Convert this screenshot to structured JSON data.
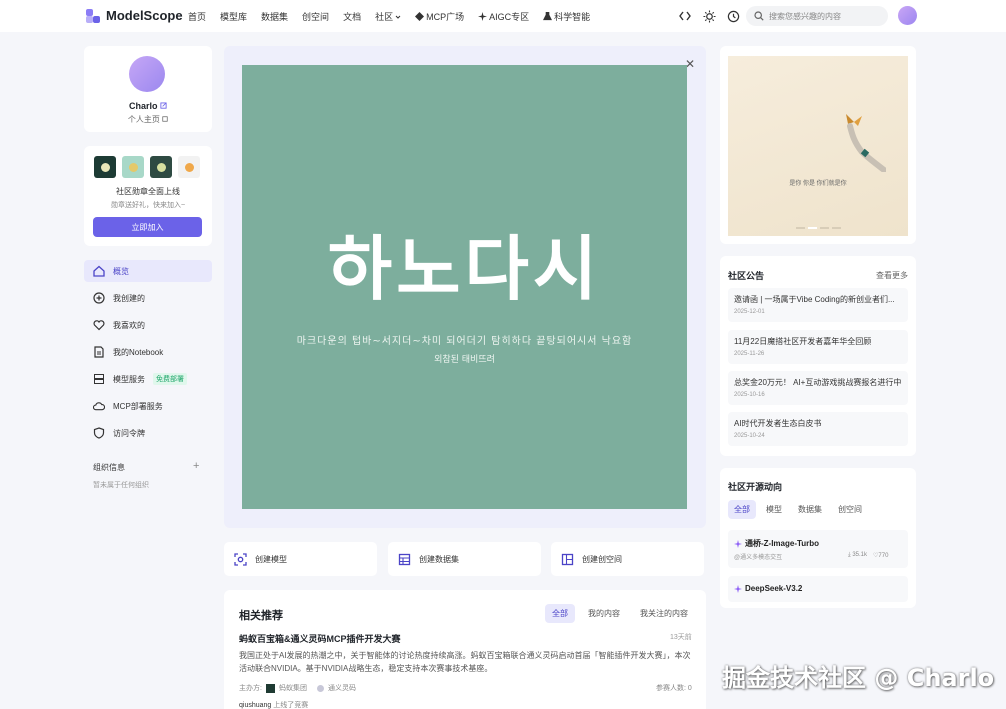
{
  "app": {
    "name": "ModelScope"
  },
  "nav": {
    "items": [
      "首页",
      "模型库",
      "数据集",
      "创空间",
      "文档",
      "社区",
      "MCP广场",
      "AIGC专区",
      "科学智能"
    ]
  },
  "search": {
    "placeholder": "搜索您感兴趣的内容"
  },
  "profile": {
    "name": "Charlo",
    "subtitle": "个人主页"
  },
  "badges": {
    "title": "社区勋章全面上线",
    "subtitle": "勋章送好礼，快来加入~",
    "join_label": "立即加入",
    "colors": [
      "#1d3b34",
      "#a8d8c8",
      "#2e4a42",
      "#f2f2f2"
    ]
  },
  "menu": {
    "items": [
      {
        "label": "概览",
        "icon": "home-icon"
      },
      {
        "label": "我创建的",
        "icon": "plus-circle-icon"
      },
      {
        "label": "我喜欢的",
        "icon": "heart-icon"
      },
      {
        "label": "我的Notebook",
        "icon": "notebook-icon"
      },
      {
        "label": "模型服务",
        "icon": "server-icon",
        "tag": "免费部署"
      },
      {
        "label": "MCP部署服务",
        "icon": "cloud-icon"
      },
      {
        "label": "访问令牌",
        "icon": "shield-icon"
      }
    ]
  },
  "org": {
    "title": "组织信息",
    "empty": "暂未属于任何组织"
  },
  "poster": {
    "title": "하노다시",
    "line1": "마크다운의 텁바~서지더~차미 되어더기 탐히하다 끝탕되어시서 낙요함",
    "line2": "외참된 태비뜨려"
  },
  "quick_actions": [
    "创建模型",
    "创建数据集",
    "创建创空间"
  ],
  "recommend": {
    "title": "相关推荐",
    "tabs": [
      "全部",
      "我的内容",
      "我关注的内容"
    ],
    "item": {
      "title": "蚂蚁百宝箱&通义灵码MCP插件开发大赛",
      "time": "13天前",
      "desc": "我国正处于AI发展的热潮之中，关于智能体的讨论热度持续高涨。蚂蚁百宝箱联合通义灵码启动首届「智能插件开发大赛」，本次活动联合NVIDIA。基于NVIDIA战略生态，稳定支持本次赛事技术基座。",
      "organizer_label": "主办方:",
      "organizers": [
        "蚂蚁集团",
        "通义灵码"
      ],
      "participants": "参赛人数: 0",
      "user": "qiushuang",
      "user_action": "上线了竞赛"
    }
  },
  "banner": {
    "caption": "是你 你是 你们就是你"
  },
  "notice": {
    "title": "社区公告",
    "more": "查看更多",
    "items": [
      {
        "title": "邀请函 | 一场属于Vibe Coding的新创业者们...",
        "date": "2025-12-01"
      },
      {
        "title": "11月22日魔搭社区开发者嘉年华全回顾",
        "date": "2025-11-26"
      },
      {
        "title": "总奖金20万元！ AI+互动游戏挑战赛报名进行中",
        "date": "2025-10-16"
      },
      {
        "title": "AI时代开发者生态白皮书",
        "date": "2025-10-24"
      }
    ]
  },
  "trends": {
    "title": "社区开源动向",
    "tabs": [
      "全部",
      "模型",
      "数据集",
      "创空间"
    ],
    "items": [
      {
        "name": "通桥-Z-Image-Turbo",
        "org": "@通义多模态交互",
        "downloads": "35.1k",
        "likes": "770"
      },
      {
        "name": "DeepSeek-V3.2",
        "org": "",
        "downloads": "",
        "likes": ""
      }
    ]
  },
  "watermark": "掘金技术社区 @ Charlo"
}
